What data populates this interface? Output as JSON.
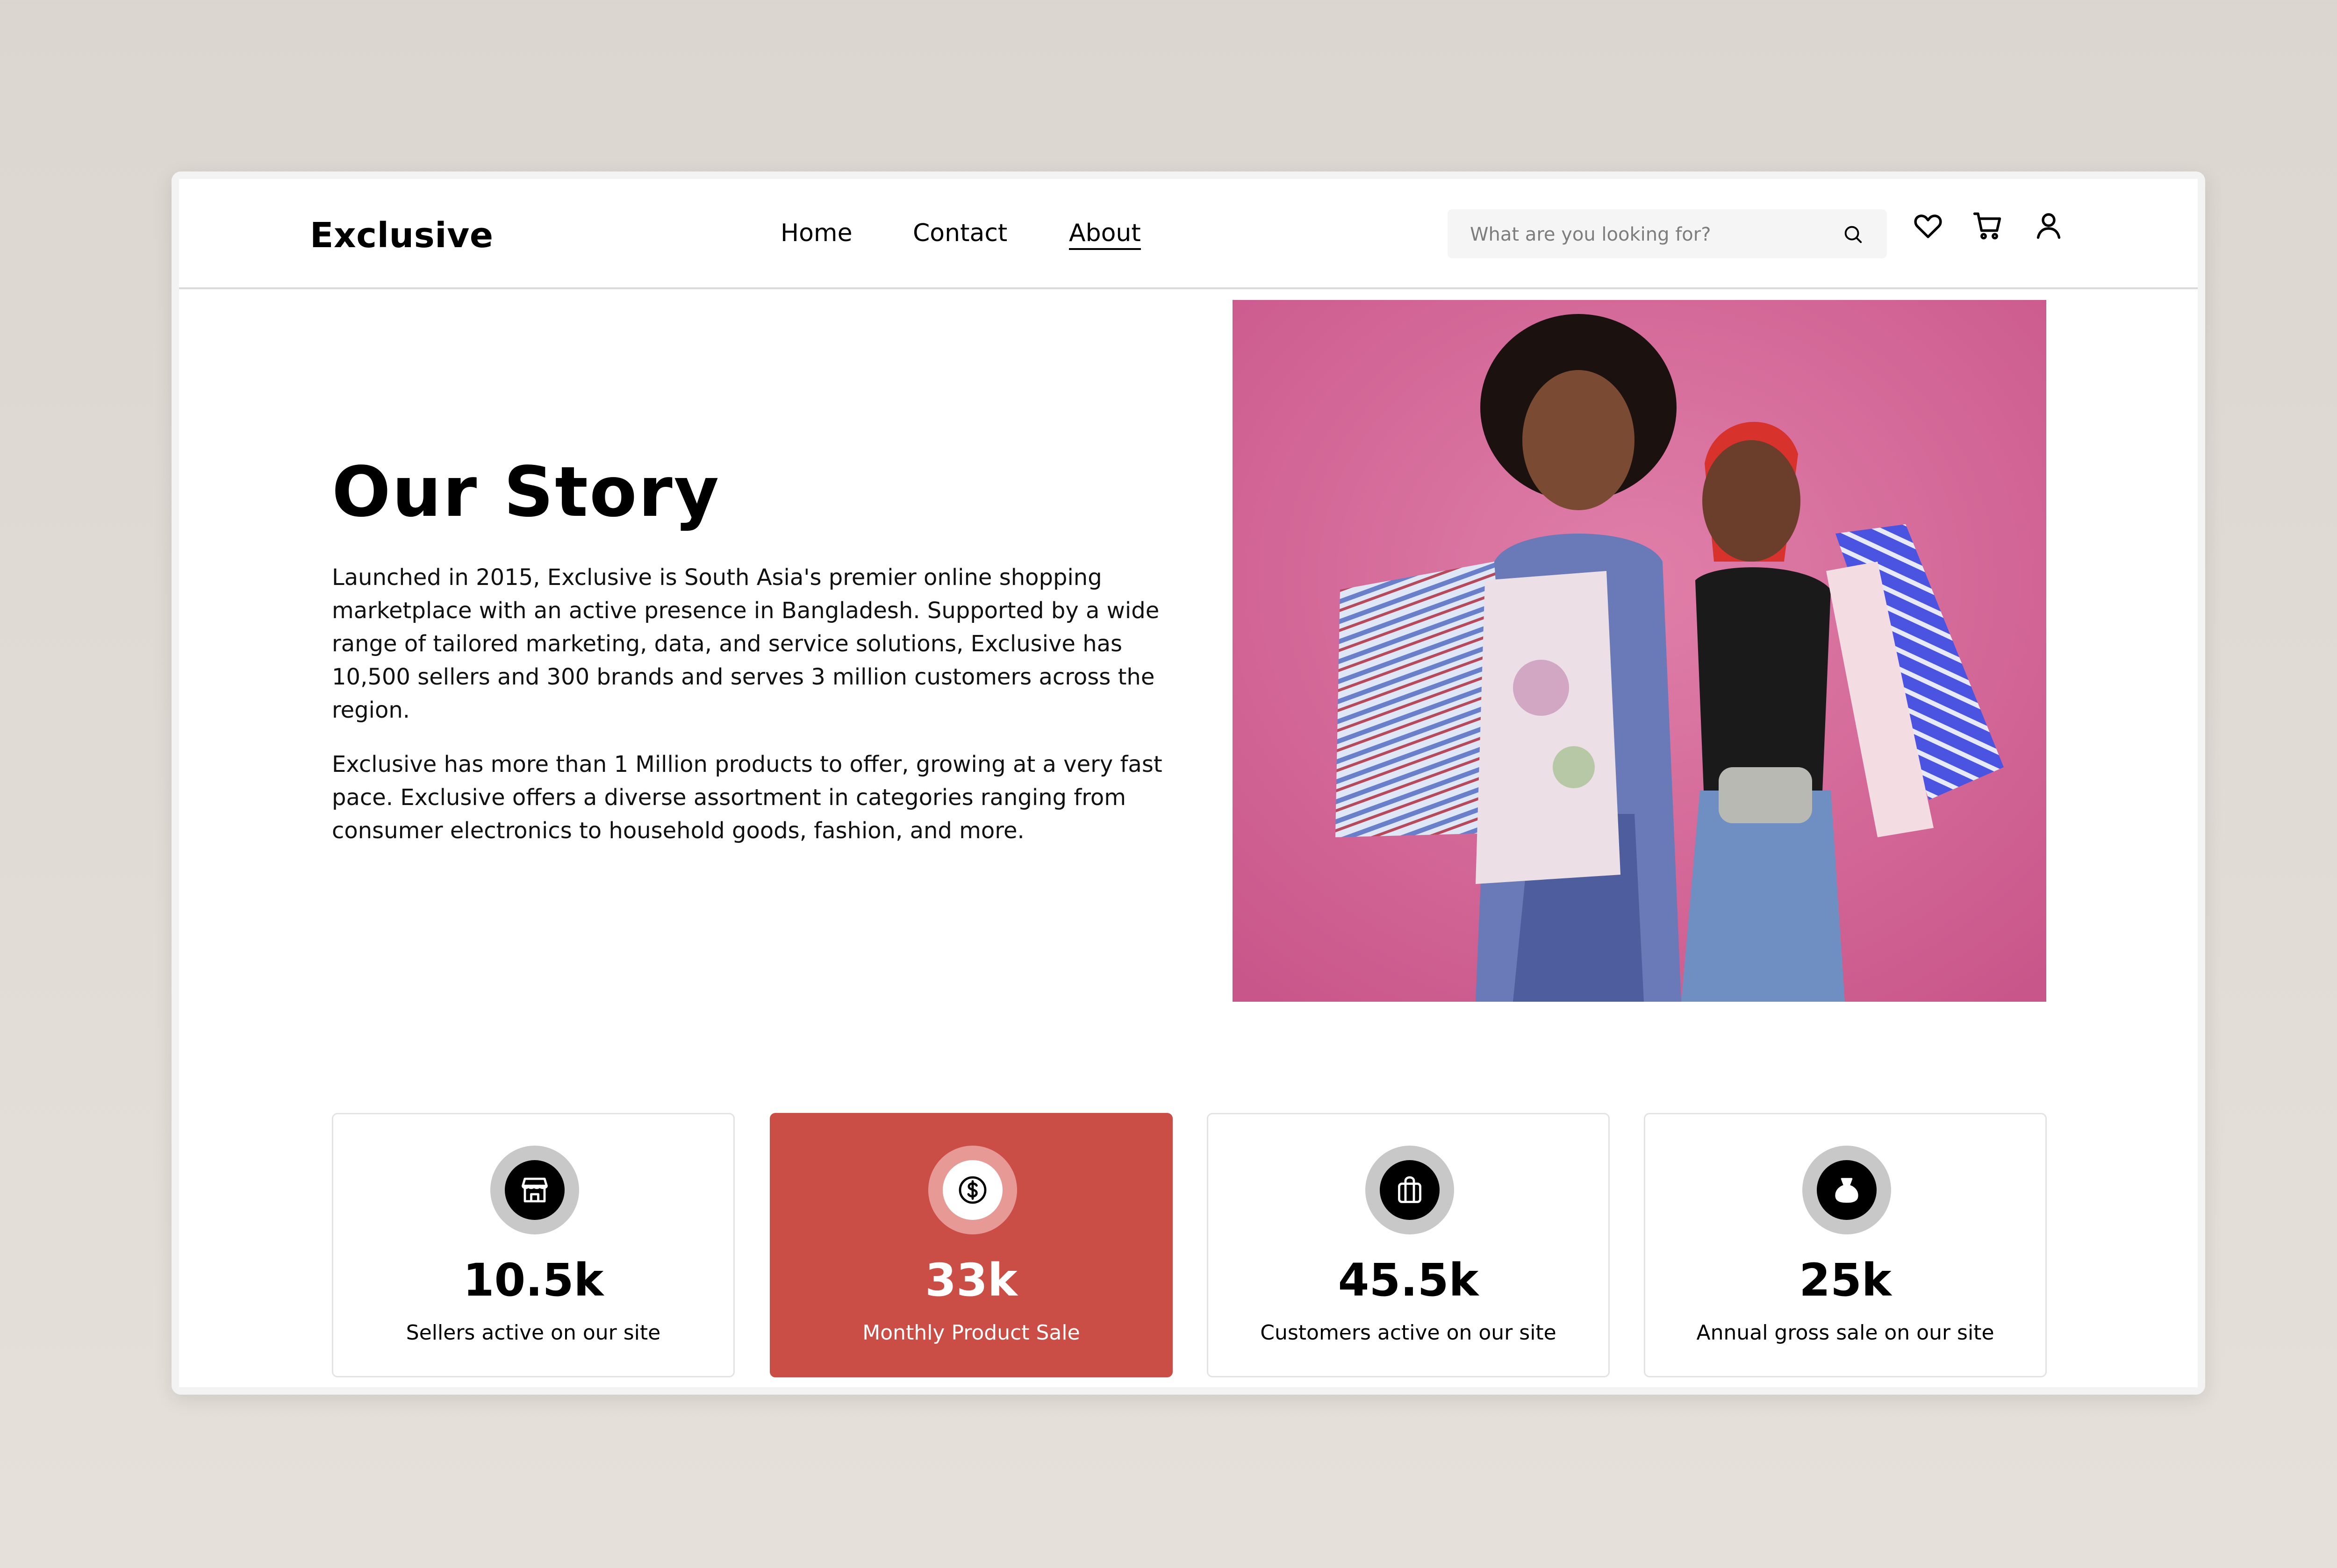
{
  "header": {
    "logo": "Exclusive",
    "nav": [
      {
        "label": "Home",
        "active": false
      },
      {
        "label": "Contact",
        "active": false
      },
      {
        "label": "About",
        "active": true
      }
    ],
    "search": {
      "placeholder": "What are you looking for?",
      "value": "",
      "icon": "search-icon"
    },
    "icons": [
      "heart-icon",
      "cart-icon",
      "user-icon"
    ]
  },
  "story": {
    "title": "Our Story",
    "paragraphs": [
      "Launched in 2015, Exclusive is South Asia's premier online shopping marketplace with an active presence in Bangladesh. Supported by a wide range of tailored marketing, data, and service solutions, Exclusive has 10,500 sellers and 300 brands and serves 3 million customers across the region.",
      "Exclusive has more than 1 Million products to offer, growing at a very fast pace. Exclusive offers a diverse assortment in categories ranging from consumer electronics to household goods, fashion, and more."
    ]
  },
  "hero_image": {
    "semantic": "two-women-shopping-bags-photo",
    "background_color": "#d86a9b"
  },
  "stats": [
    {
      "value": "10.5k",
      "label": "Sellers active on our site",
      "icon": "shop-icon",
      "highlighted": false
    },
    {
      "value": "33k",
      "label": "Monthly Product Sale",
      "icon": "dollar-icon",
      "highlighted": true
    },
    {
      "value": "45.5k",
      "label": "Customers active on our site",
      "icon": "shopping-bag-icon",
      "highlighted": false
    },
    {
      "value": "25k",
      "label": "Annual gross sale on our site",
      "icon": "money-bag-icon",
      "highlighted": false
    }
  ],
  "colors": {
    "accent": "#cb4e46",
    "badge_gray": "#c8c8c8",
    "border": "#e3e3e3"
  }
}
